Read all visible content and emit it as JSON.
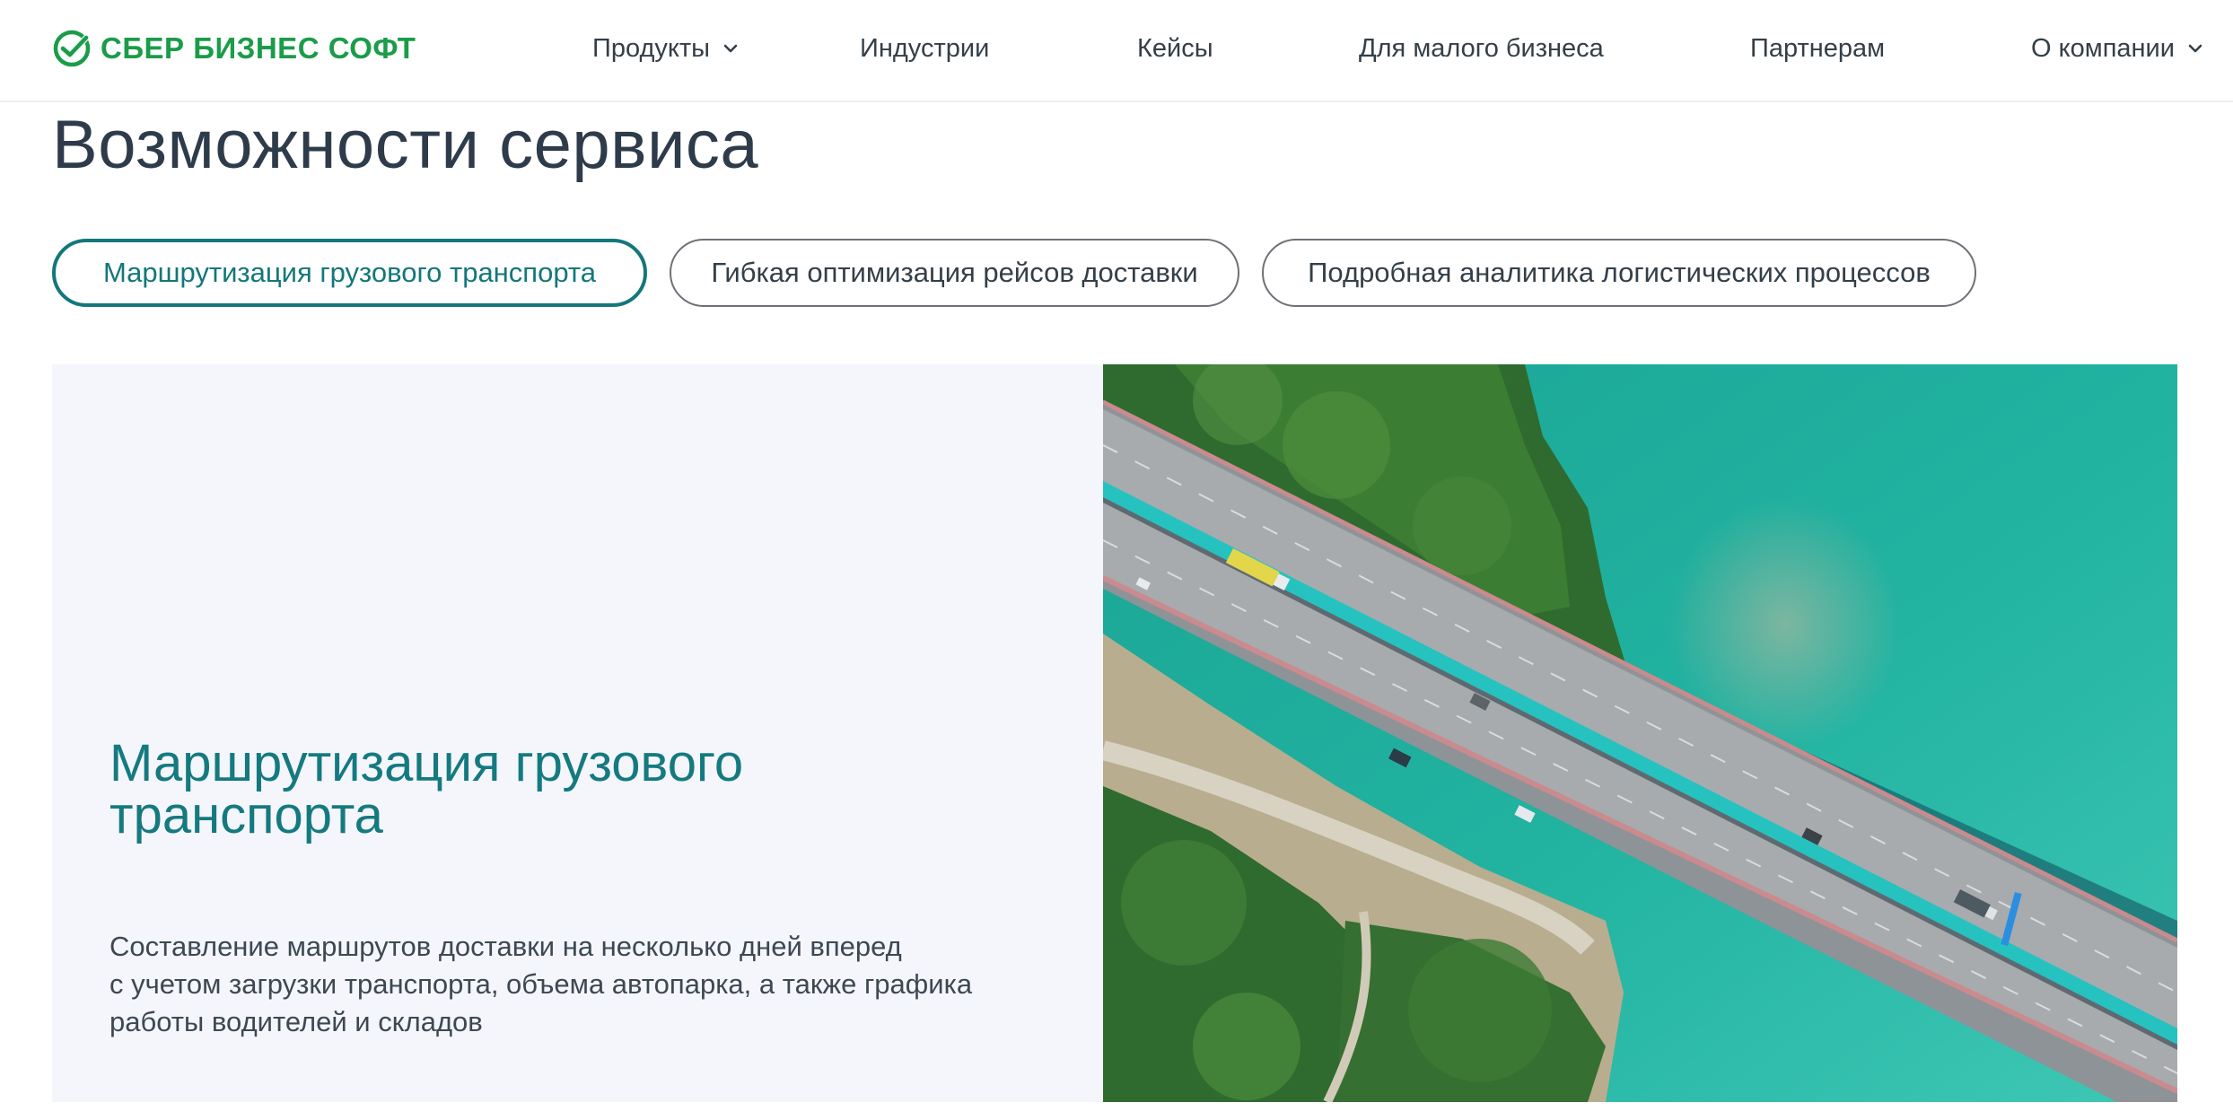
{
  "header": {
    "logo_text": "СБЕР БИЗНЕС СОФТ",
    "nav": [
      {
        "label": "Продукты",
        "has_dropdown": true
      },
      {
        "label": "Индустрии",
        "has_dropdown": false
      },
      {
        "label": "Кейсы",
        "has_dropdown": false
      },
      {
        "label": "Для малого бизнеса",
        "has_dropdown": false
      },
      {
        "label": "Партнерам",
        "has_dropdown": false
      },
      {
        "label": "О компании",
        "has_dropdown": true
      }
    ]
  },
  "main": {
    "title": "Возможности сервиса",
    "tabs": [
      {
        "label": "Маршрутизация грузового транспорта",
        "active": true
      },
      {
        "label": "Гибкая оптимизация рейсов доставки",
        "active": false
      },
      {
        "label": "Подробная аналитика логистических процессов",
        "active": false
      }
    ],
    "card": {
      "heading_line1": "Маршрутизация грузового",
      "heading_line2": "транспорта",
      "text_line1": "Составление маршрутов доставки на несколько дней вперед",
      "text_line2": "с учетом загрузки транспорта, объема автопарка, а также графика",
      "text_line3": "работы водителей и складов",
      "image_alt": "aerial-bridge-photo"
    }
  },
  "colors": {
    "brand_green": "#1a9c49",
    "accent_teal": "#13777b",
    "card_bg": "#f4f6fb",
    "text_dark": "#2e3b4a"
  }
}
